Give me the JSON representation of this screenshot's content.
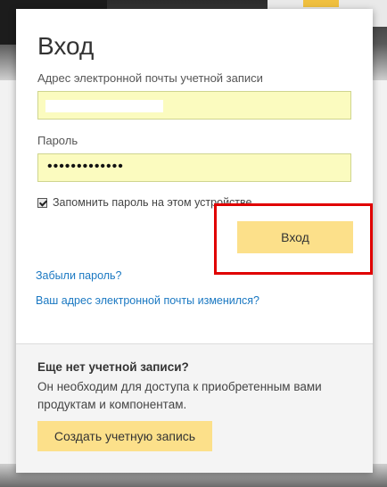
{
  "page": {
    "title": "Вход",
    "email_label": "Адрес электронной почты учетной записи",
    "password_label": "Пароль",
    "password_masked": "•••••••••••••",
    "remember_label": "Запомнить пароль на этом устройстве",
    "login_button": "Вход",
    "forgot_password_link": "Забыли пароль?",
    "email_changed_link": "Ваш адрес электронной почты изменился?"
  },
  "signup": {
    "heading": "Еще нет учетной записи?",
    "description": "Он необходим для доступа к приобретенным вами продуктам и компонентам.",
    "create_button": "Создать учетную запись"
  },
  "colors": {
    "input_bg": "#fbfbbf",
    "button_bg": "#fce08a",
    "link": "#1a78c2",
    "highlight": "#e00000"
  }
}
